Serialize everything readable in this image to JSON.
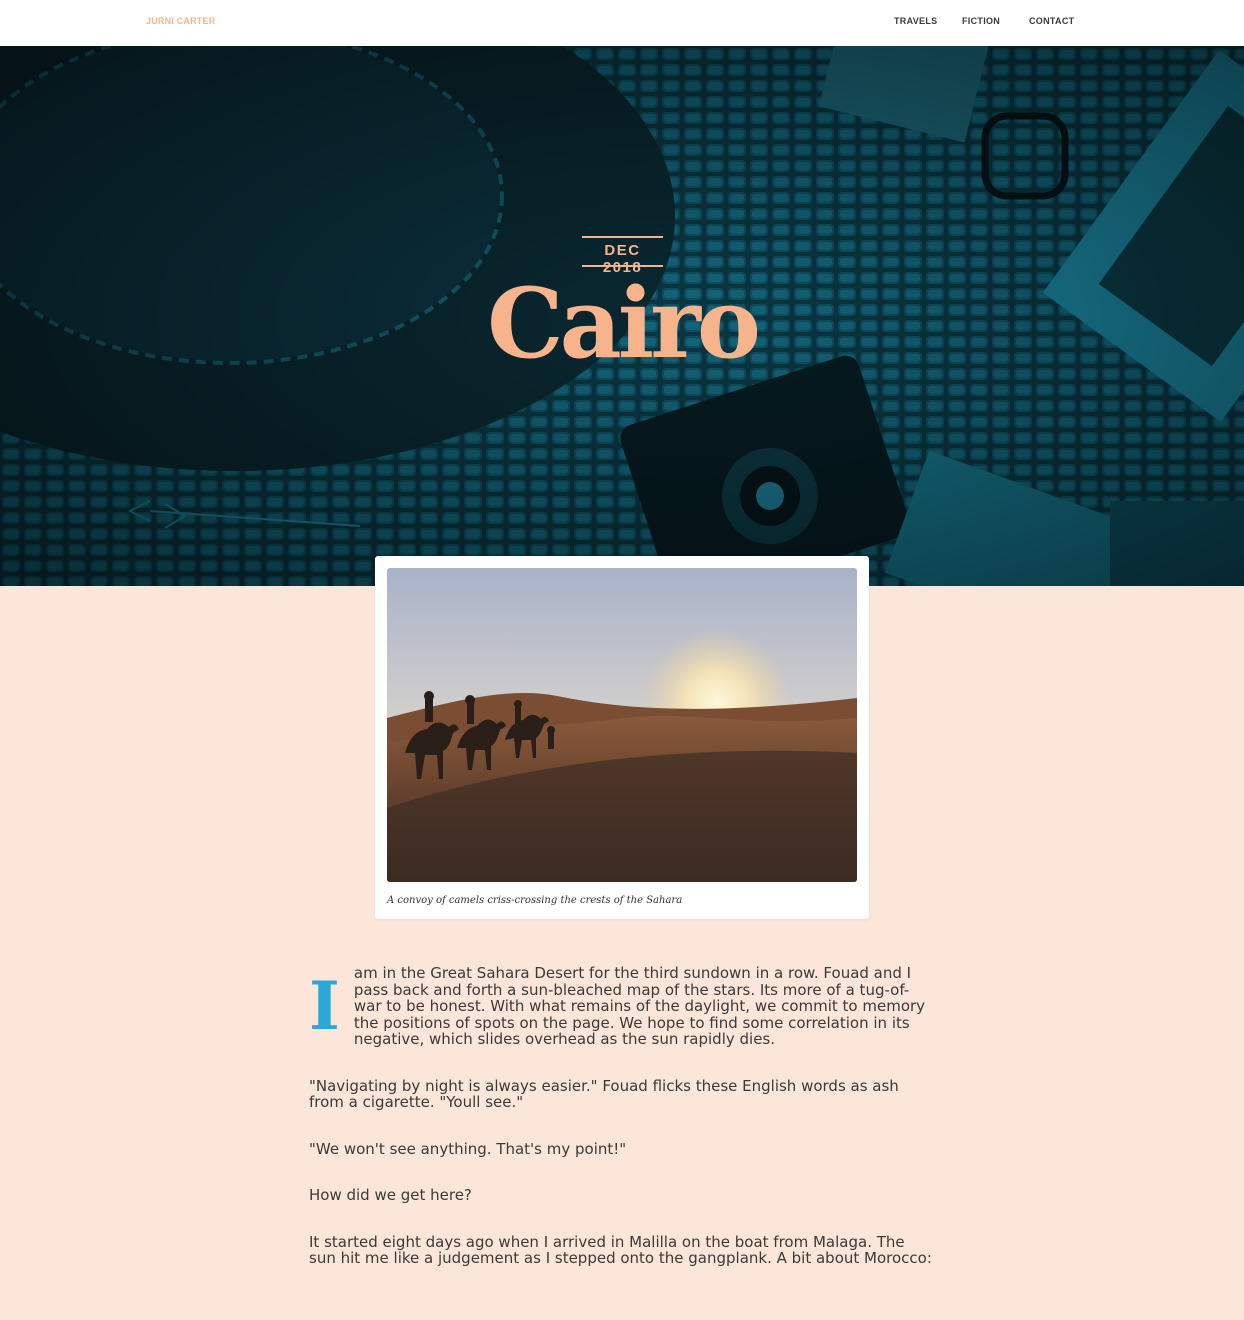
{
  "header": {
    "brand": "JURNI CARTER",
    "nav": [
      {
        "label": "TRAVELS"
      },
      {
        "label": "FICTION"
      },
      {
        "label": "CONTACT"
      }
    ]
  },
  "hero": {
    "date": "DEC 2018",
    "title": "Cairo"
  },
  "figure": {
    "caption": "A convoy of camels criss-crossing the crests of the Sahara"
  },
  "article": {
    "dropcap": "I",
    "paragraphs": [
      "am in the Great Sahara Desert for the third sundown in a row. Fouad and I pass back and forth a sun-bleached map of the stars. Its more of a tug-of-war to be honest. With what remains of the daylight, we commit to memory the positions of spots on the page. We hope to find some correlation in its negative, which slides overhead as the sun rapidly dies.",
      "\"Navigating by night is always easier.\" Fouad flicks these English words as ash from a cigarette. \"Youll see.\"",
      "\"We won't see anything. That's my point!\"",
      "How did we get here?",
      "It started eight days ago when I arrived in Malilla on the boat from Malaga. The sun hit me like a judgement as I stepped onto the gangplank. A bit about Morocco:"
    ]
  },
  "colors": {
    "accent": "#f7b48c",
    "dropcap": "#2aa9d9",
    "page_bg": "#fce5d9",
    "hero_bg": "#08303b"
  }
}
